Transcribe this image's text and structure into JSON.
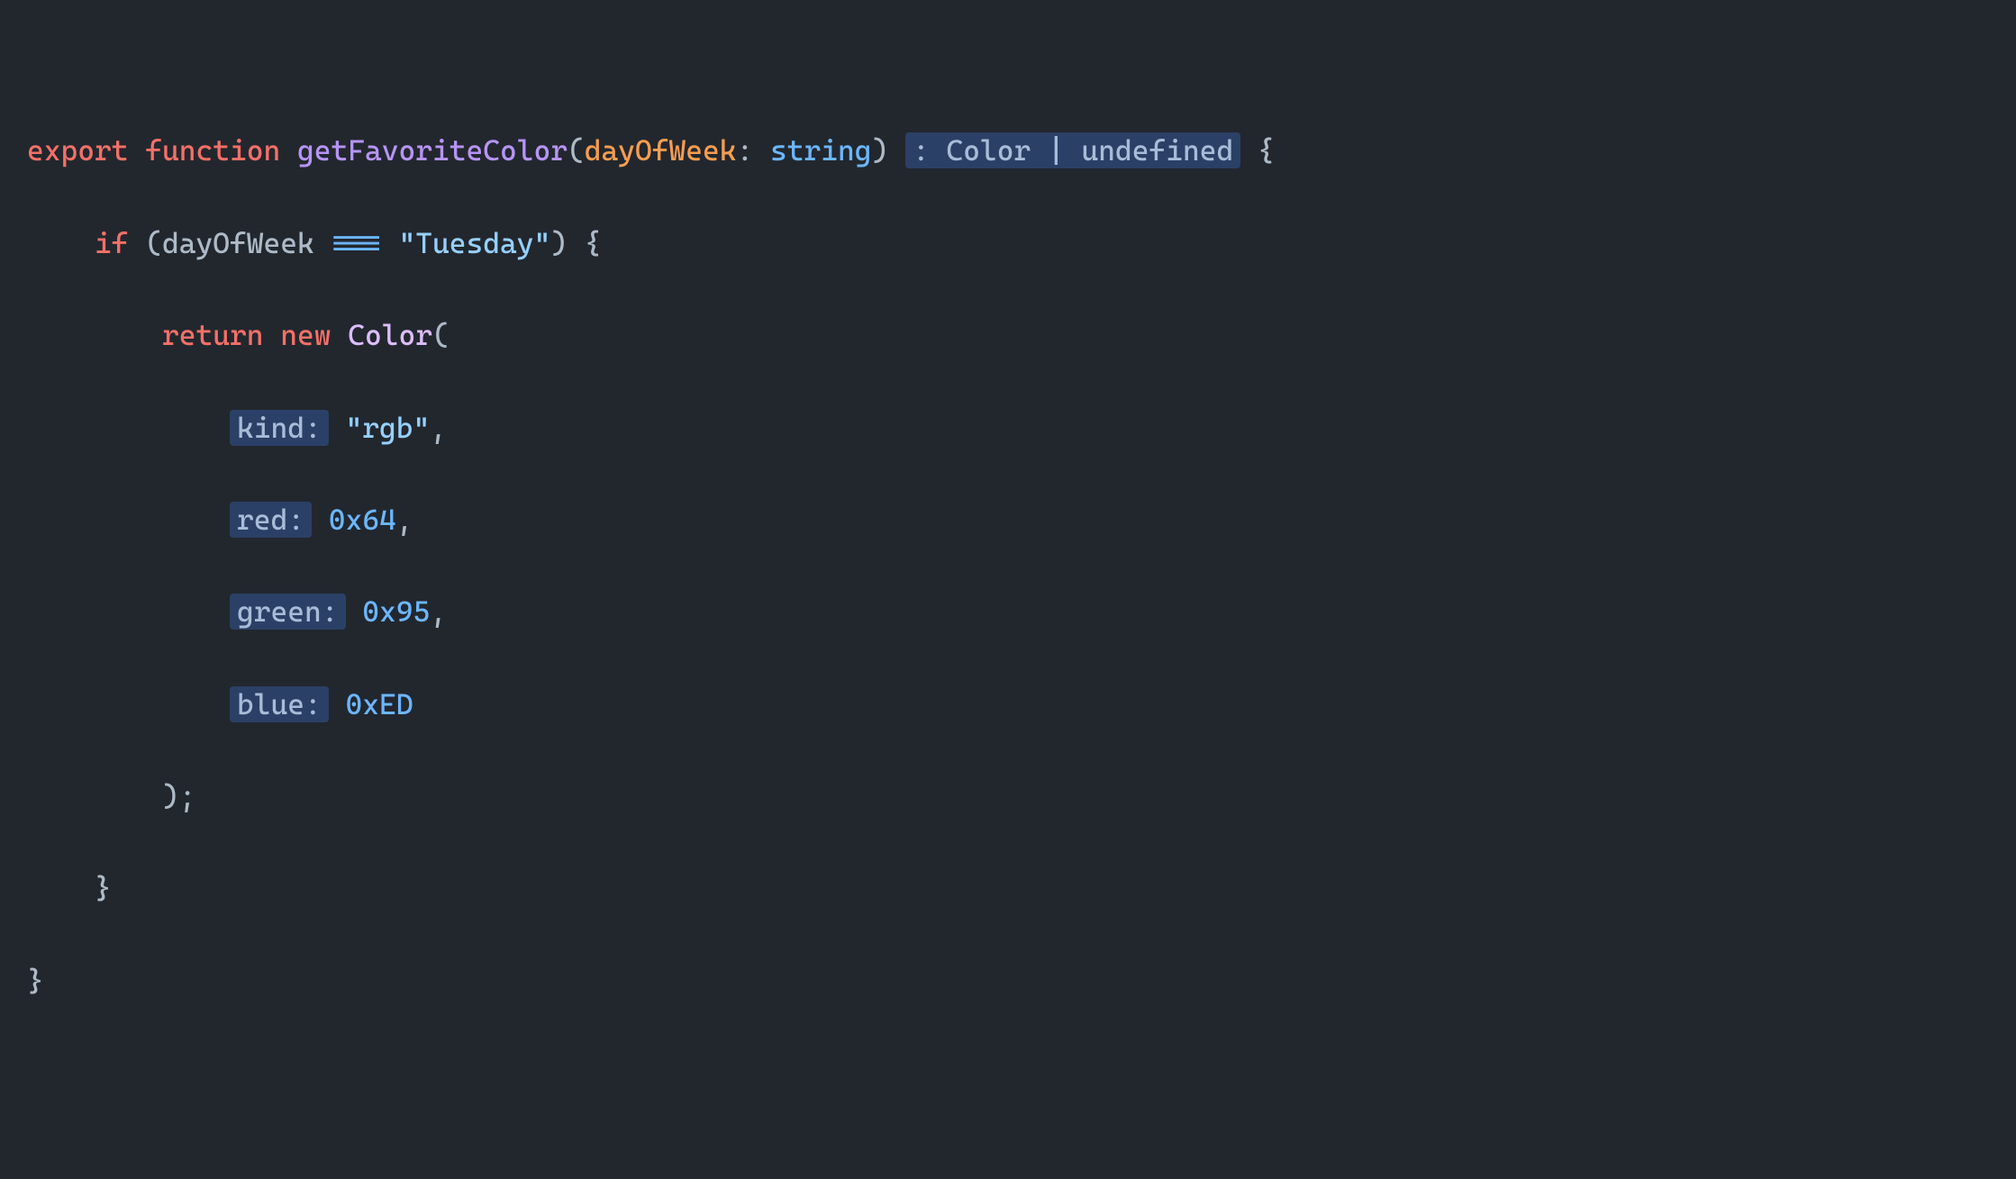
{
  "tokens": {
    "export": "export",
    "function": "function",
    "funcName": "getFavoriteColor",
    "param": "dayOfWeek",
    "paramType": "string",
    "returnHint": ": Color | undefined",
    "if": "if",
    "condVar": "dayOfWeek",
    "eq": "===",
    "strTuesday": "\"Tuesday\"",
    "return": "return",
    "new": "new",
    "ctor": "Color",
    "hintKind": "kind:",
    "valKind": "\"rgb\"",
    "hintRed": "red:",
    "valRed": "0x64",
    "hintGreen": "green:",
    "valGreen": "0x95",
    "hintBlue": "blue:",
    "valBlue": "0xED"
  }
}
